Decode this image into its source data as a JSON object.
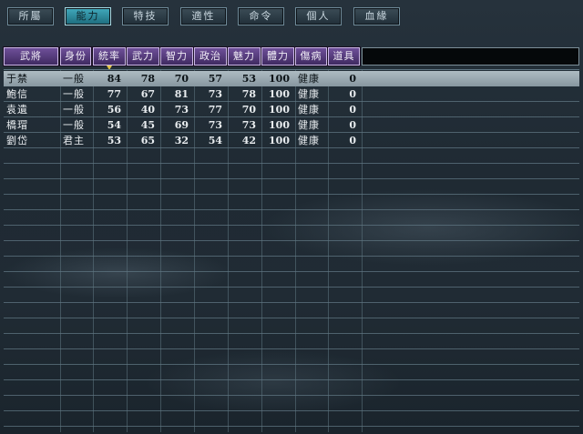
{
  "tabs": [
    {
      "label": "所屬",
      "active": false
    },
    {
      "label": "能力",
      "active": true
    },
    {
      "label": "特技",
      "active": false
    },
    {
      "label": "適性",
      "active": false
    },
    {
      "label": "命令",
      "active": false
    },
    {
      "label": "個人",
      "active": false
    },
    {
      "label": "血緣",
      "active": false
    }
  ],
  "table": {
    "columns": [
      "武將",
      "身份",
      "統率",
      "武力",
      "智力",
      "政治",
      "魅力",
      "體力",
      "傷病",
      "道具"
    ],
    "sort_column": "統率",
    "rows": [
      {
        "name": "于禁",
        "rank": "一般",
        "lead": "84",
        "war": "78",
        "int": "70",
        "pol": "57",
        "cha": "53",
        "hp": "100",
        "health": "健康",
        "items": "0",
        "selected": true
      },
      {
        "name": "鮑信",
        "rank": "一般",
        "lead": "77",
        "war": "67",
        "int": "81",
        "pol": "73",
        "cha": "78",
        "hp": "100",
        "health": "健康",
        "items": "0",
        "selected": false
      },
      {
        "name": "袁遺",
        "rank": "一般",
        "lead": "56",
        "war": "40",
        "int": "73",
        "pol": "77",
        "cha": "70",
        "hp": "100",
        "health": "健康",
        "items": "0",
        "selected": false
      },
      {
        "name": "橋瑁",
        "rank": "一般",
        "lead": "54",
        "war": "45",
        "int": "69",
        "pol": "73",
        "cha": "73",
        "hp": "100",
        "health": "健康",
        "items": "0",
        "selected": false
      },
      {
        "name": "劉岱",
        "rank": "君主",
        "lead": "53",
        "war": "65",
        "int": "32",
        "pol": "54",
        "cha": "42",
        "hp": "100",
        "health": "健康",
        "items": "0",
        "selected": false
      }
    ]
  }
}
